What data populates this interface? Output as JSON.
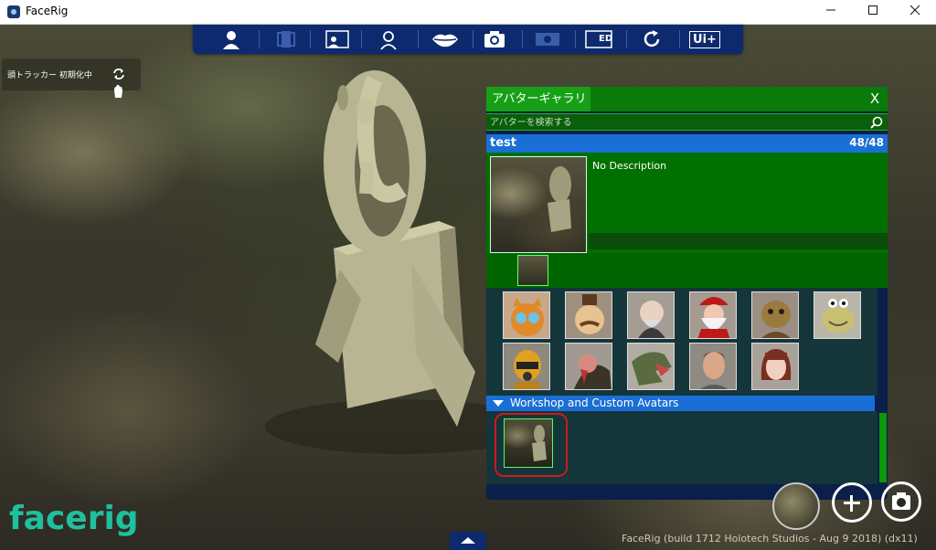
{
  "window": {
    "title": "FaceRig",
    "minimize_icon": "minimize-icon",
    "maximize_icon": "maximize-icon",
    "close_icon": "close-icon"
  },
  "toolbar": {
    "icons": [
      "avatar-icon",
      "background-icon",
      "scene-icon",
      "tracking-icon",
      "lips-icon",
      "camera-icon",
      "film-icon",
      "ed-icon",
      "reset-icon",
      "ui-plus-icon"
    ],
    "ed_label": "ED",
    "ui_label": "Ui+",
    "accent": "#0d2a6e"
  },
  "tracker": {
    "status": "頭トラッカー 初期化中",
    "icons": [
      "refresh-icon",
      "hand-icon"
    ]
  },
  "gallery": {
    "title": "アバターギャラリー",
    "close_label": "X",
    "search_placeholder": "アバターを検索する",
    "selected": {
      "name": "test",
      "count": "48/48",
      "description": "No Description"
    },
    "avatars": [
      "orange-cat-avatar",
      "mustache-man-avatar",
      "old-man-avatar",
      "santa-avatar",
      "goblin-avatar",
      "worm-avatar",
      "robot-avatar",
      "turkey-avatar",
      "dinosaur-avatar",
      "man-avatar",
      "woman-avatar"
    ],
    "workshop_label": "Workshop and Custom Avatars",
    "colors": {
      "header_green": "#0a7a0a",
      "tab_green": "#16a016",
      "selection_blue": "#1a6fd6",
      "panel_dark": "#14353a",
      "highlight_red": "#d01818"
    }
  },
  "footer": {
    "logo": "facerig",
    "build": "FaceRig (build 1712 Holotech Studios - Aug  9 2018) (dx11)"
  }
}
